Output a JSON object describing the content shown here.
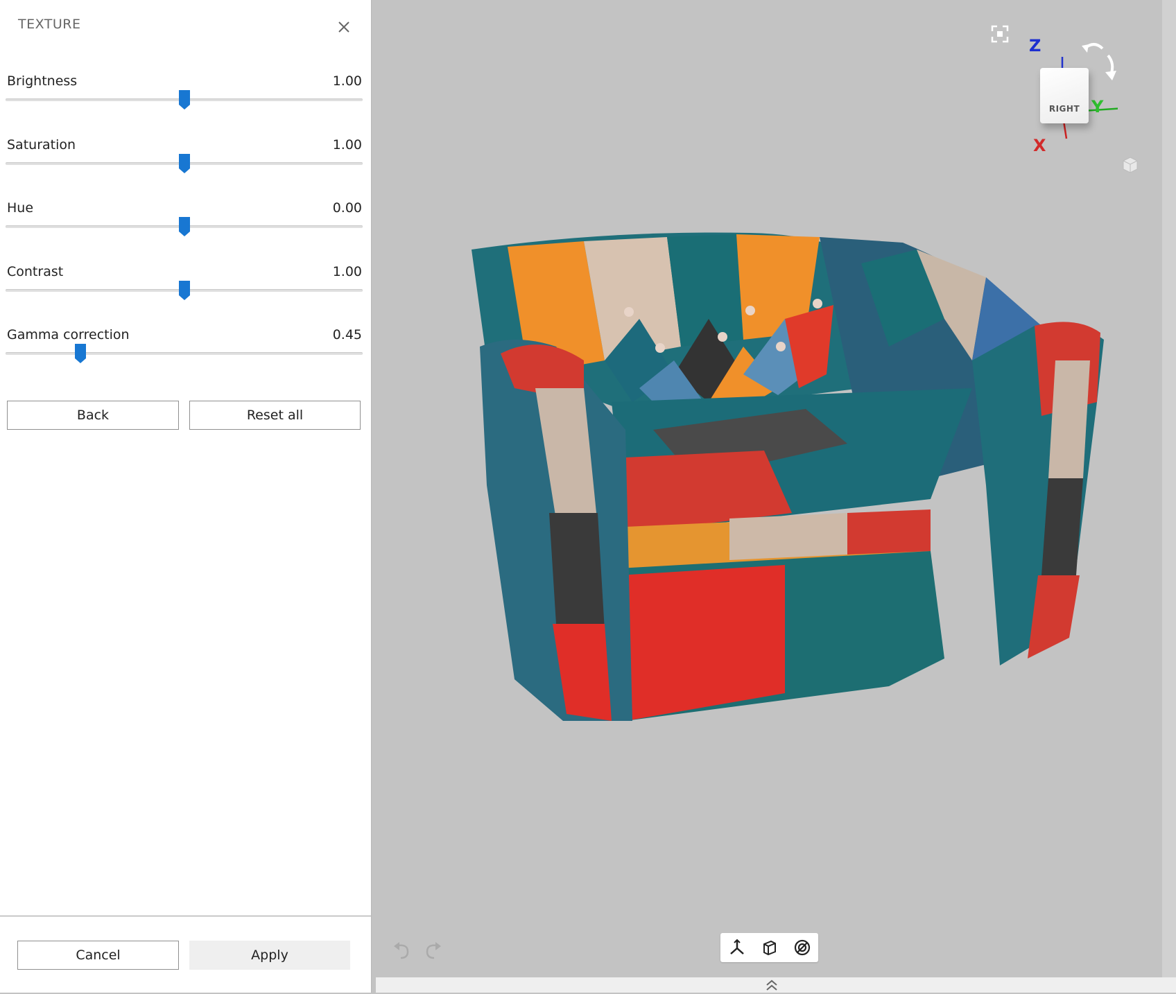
{
  "panel": {
    "title": "TEXTURE",
    "sliders": [
      {
        "label": "Brightness",
        "value": "1.00",
        "level": 0.5
      },
      {
        "label": "Saturation",
        "value": "1.00",
        "level": 0.5
      },
      {
        "label": "Hue",
        "value": "0.00",
        "level": 0.5
      },
      {
        "label": "Contrast",
        "value": "1.00",
        "level": 0.5
      },
      {
        "label": "Gamma correction",
        "value": "0.45",
        "level": 0.21
      }
    ],
    "back_label": "Back",
    "reset_label": "Reset all",
    "cancel_label": "Cancel",
    "apply_label": "Apply"
  },
  "viewport": {
    "view_cube_face": "RIGHT",
    "axes": {
      "z": "Z",
      "y": "Y",
      "x": "X"
    },
    "icons": [
      "fit-view-icon",
      "rotate-left-icon",
      "rotate-right-icon",
      "view-cube-menu-icon",
      "undo-icon",
      "redo-icon",
      "axes-icon",
      "box-view-icon",
      "target-icon",
      "expand-up-icon",
      "collapse-right-icon"
    ]
  },
  "colors": {
    "accent": "#1a73c8",
    "slider_thumb": "#1877d2"
  }
}
